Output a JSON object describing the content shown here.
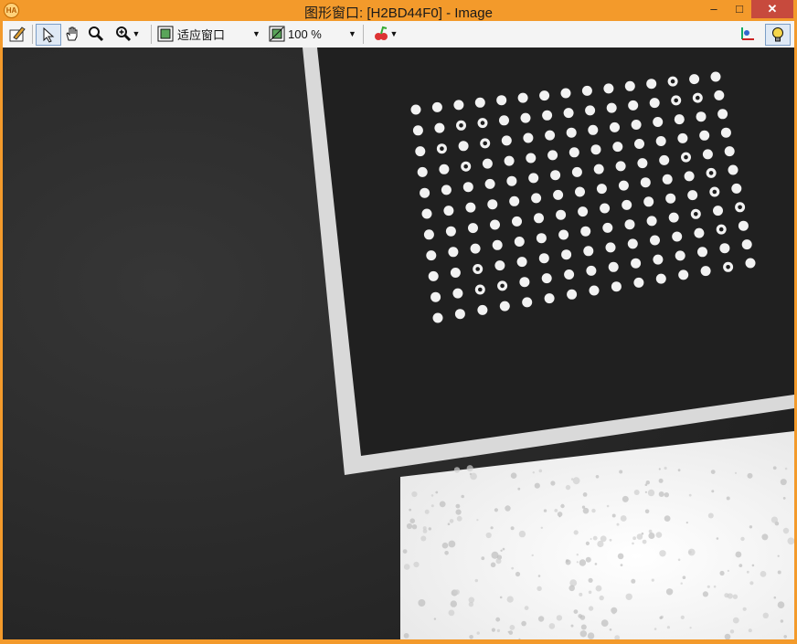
{
  "window": {
    "title": "图形窗口: [H2BD44F0] - Image",
    "app_badge": "HA",
    "controls": {
      "minimize": "–",
      "maximize": "□",
      "close": "✕"
    }
  },
  "toolbar": {
    "fit_mode_label": "适应窗口",
    "zoom_label": "100 %"
  },
  "image": {
    "subject": "calibration plate",
    "colors": {
      "background_dark": "#2b2b2b",
      "plate": "#1e1e1e",
      "border": "#d8d8d8",
      "foam": "#f4f4f4",
      "dots": "#f2f2f2"
    }
  }
}
